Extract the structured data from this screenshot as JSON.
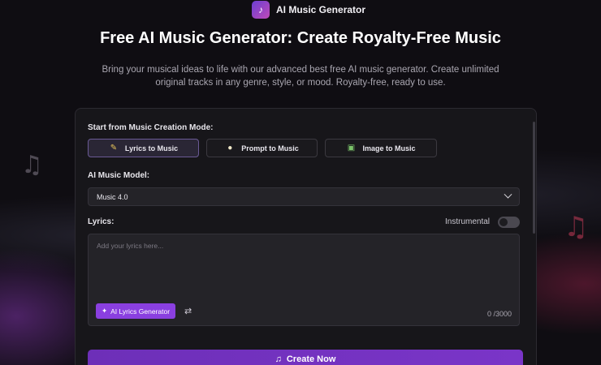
{
  "header": {
    "badge_logo": "♪",
    "badge_text": "AI Music Generator",
    "title": "Free AI Music Generator: Create Royalty-Free Music",
    "subtitle": "Bring your musical ideas to life with our advanced best free AI music generator. Create unlimited original tracks in any genre, style, or mood. Royalty-free, ready to use."
  },
  "form": {
    "mode_label": "Start from Music Creation Mode:",
    "modes": [
      {
        "label": "Lyrics to Music",
        "icon": "document-icon",
        "glyph": "✎",
        "active": true
      },
      {
        "label": "Prompt to Music",
        "icon": "lightbulb-icon",
        "glyph": "●",
        "active": false
      },
      {
        "label": "Image to Music",
        "icon": "image-icon",
        "glyph": "▣",
        "active": false
      }
    ],
    "model_label": "AI Music Model:",
    "model_value": "Music 4.0",
    "lyrics_label": "Lyrics:",
    "instrumental_label": "Instrumental",
    "instrumental_on": false,
    "lyrics_placeholder": "Add your lyrics here...",
    "lyrics_generator_label": "AI Lyrics Generator",
    "char_count": "0 /3000",
    "create_label": "Create Now"
  },
  "colors": {
    "accent": "#8a3fe0",
    "create_button": "#7a35c8",
    "background": "#0f0d12",
    "card": "#17161a"
  }
}
